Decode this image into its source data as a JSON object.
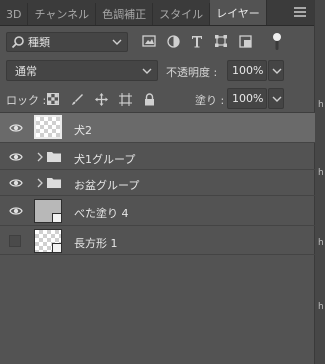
{
  "tabs": [
    {
      "label": "3D",
      "active": false
    },
    {
      "label": "チャンネル",
      "active": false
    },
    {
      "label": "色調補正",
      "active": false
    },
    {
      "label": "スタイル",
      "active": false
    },
    {
      "label": "レイヤー",
      "active": true
    }
  ],
  "filter": {
    "kind_label": "種類",
    "icons": [
      "pixel-filter-icon",
      "adjustment-filter-icon",
      "type-filter-icon",
      "shape-filter-icon",
      "smart-object-filter-icon"
    ]
  },
  "blend": {
    "mode": "通常",
    "opacity_label": "不透明度 :",
    "opacity_value": "100%"
  },
  "lock": {
    "label": "ロック :",
    "icons": [
      "lock-transparent-icon",
      "lock-image-icon",
      "lock-position-icon",
      "lock-artboard-icon",
      "lock-all-icon"
    ],
    "fill_label": "塗り :",
    "fill_value": "100%"
  },
  "layers": [
    {
      "name": "犬2",
      "visible": true,
      "type": "pixel",
      "selected": true
    },
    {
      "name": "犬1グループ",
      "visible": true,
      "type": "group",
      "selected": false
    },
    {
      "name": "お盆グループ",
      "visible": true,
      "type": "group",
      "selected": false
    },
    {
      "name": "べた塗り 4",
      "visible": true,
      "type": "fill",
      "selected": false
    },
    {
      "name": "長方形 1",
      "visible": false,
      "type": "shape",
      "selected": false
    }
  ],
  "right_strip_letters": [
    "h",
    "h",
    "h",
    "h"
  ]
}
